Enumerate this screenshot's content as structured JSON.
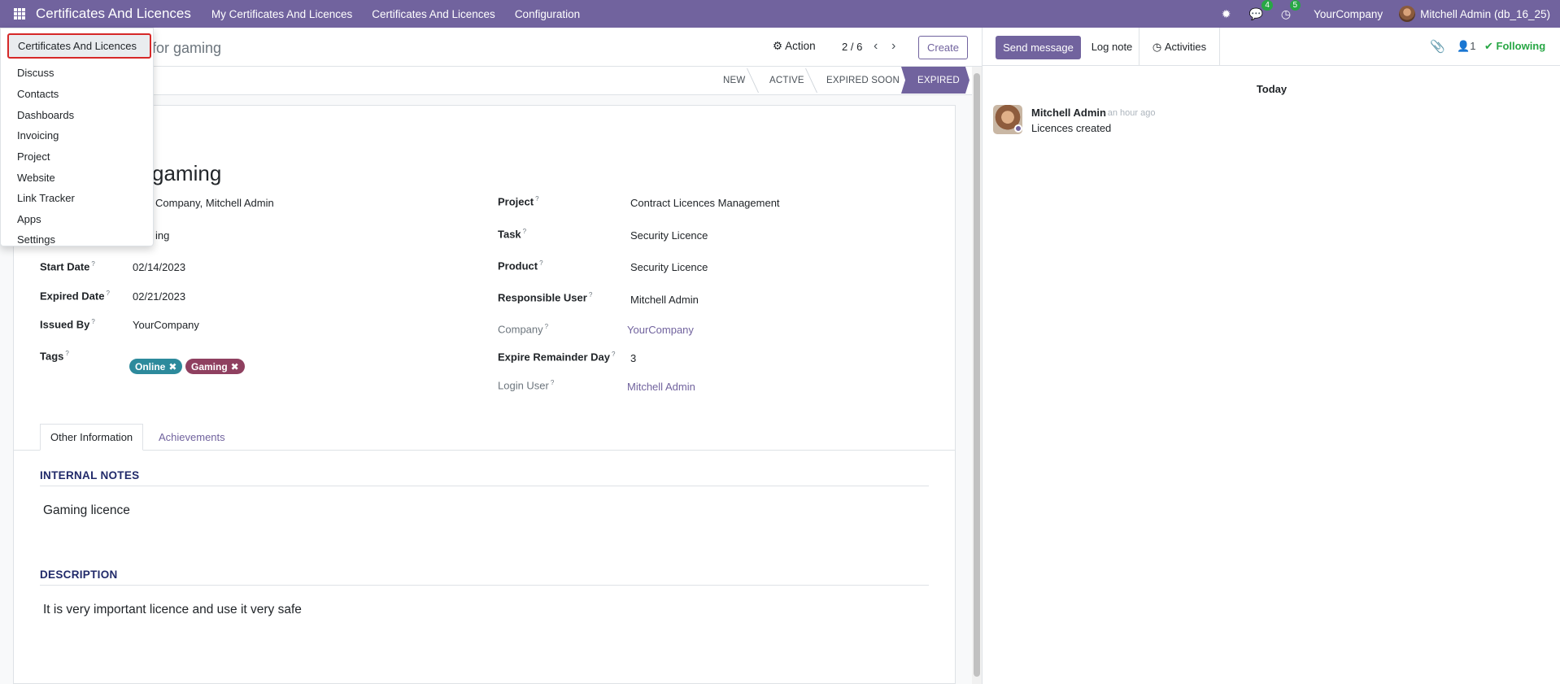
{
  "navbar": {
    "brand": "Certificates And Licences",
    "menus": [
      "My Certificates And Licences",
      "Certificates And Licences",
      "Configuration"
    ],
    "messages_count": "4",
    "activities_count": "5",
    "company": "YourCompany",
    "user": "Mitchell Admin (db_16_25)"
  },
  "apps_menu": {
    "items": [
      "Certificates And Licences",
      "Discuss",
      "Contacts",
      "Dashboards",
      "Invoicing",
      "Project",
      "Website",
      "Link Tracker",
      "Apps",
      "Settings"
    ]
  },
  "control_panel": {
    "record_title": "e for gaming",
    "action_label": "Action",
    "pager_value": "2 / 6",
    "create_label": "Create"
  },
  "statusbar": {
    "stages": [
      "NEW",
      "ACTIVE",
      "EXPIRED SOON",
      "EXPIRED"
    ],
    "current": "EXPIRED"
  },
  "form": {
    "title": "gaming",
    "left": {
      "row1_value": "Company, Mitchell Admin",
      "row2_value": "ing",
      "start_date_label": "Start Date",
      "start_date": "02/14/2023",
      "expired_date_label": "Expired Date",
      "expired_date": "02/21/2023",
      "issued_by_label": "Issued By",
      "issued_by": "YourCompany",
      "tags_label": "Tags",
      "tags": [
        {
          "name": "Online",
          "color": "#2d8a9c"
        },
        {
          "name": "Gaming",
          "color": "#8f4060"
        }
      ]
    },
    "right": {
      "project_label": "Project",
      "project": "Contract Licences Management",
      "task_label": "Task",
      "task": "Security Licence",
      "product_label": "Product",
      "product": "Security Licence",
      "responsible_label": "Responsible User",
      "responsible": "Mitchell Admin",
      "company_label": "Company",
      "company": "YourCompany",
      "expire_day_label": "Expire Remainder Day",
      "expire_day": "3",
      "login_user_label": "Login User",
      "login_user": "Mitchell Admin"
    },
    "tabs": [
      "Other Information",
      "Achievements"
    ],
    "internal_notes_heading": "INTERNAL NOTES",
    "internal_notes": "Gaming licence",
    "description_heading": "DESCRIPTION",
    "description": "It is very important licence and use it very safe"
  },
  "chatter": {
    "send_message": "Send message",
    "log_note": "Log note",
    "activities": "Activities",
    "followers": "1",
    "following": "Following",
    "date_separator": "Today",
    "message": {
      "author": "Mitchell Admin",
      "time": "- an hour ago",
      "body": "Licences created"
    }
  },
  "colors": {
    "brand": "#71639e",
    "success": "#28a745",
    "highlight": "#d62828"
  }
}
